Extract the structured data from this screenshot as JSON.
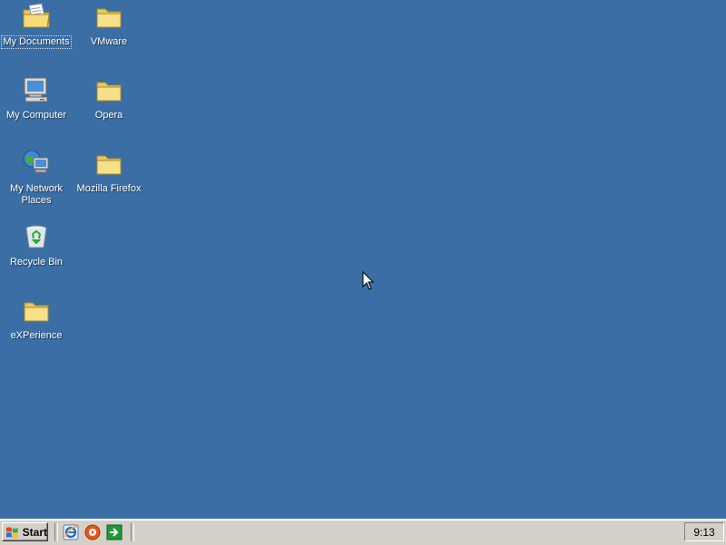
{
  "desktop": {
    "background_color": "#3a6ea5",
    "icons": [
      {
        "label": "My Documents",
        "icon": "my-documents-icon"
      },
      {
        "label": "VMware",
        "icon": "folder-icon"
      },
      {
        "label": "My Computer",
        "icon": "my-computer-icon"
      },
      {
        "label": "Opera",
        "icon": "folder-icon"
      },
      {
        "label": "My Network Places",
        "icon": "network-places-icon"
      },
      {
        "label": "Mozilla Firefox",
        "icon": "folder-icon"
      },
      {
        "label": "Recycle Bin",
        "icon": "recycle-bin-icon"
      },
      {
        "label": "eXPerience",
        "icon": "folder-icon"
      }
    ]
  },
  "taskbar": {
    "start_label": "Start",
    "quick_launch": [
      {
        "icon": "internet-explorer-icon"
      },
      {
        "icon": "media-player-icon"
      },
      {
        "icon": "show-desktop-icon"
      }
    ],
    "clock": "9:13"
  }
}
